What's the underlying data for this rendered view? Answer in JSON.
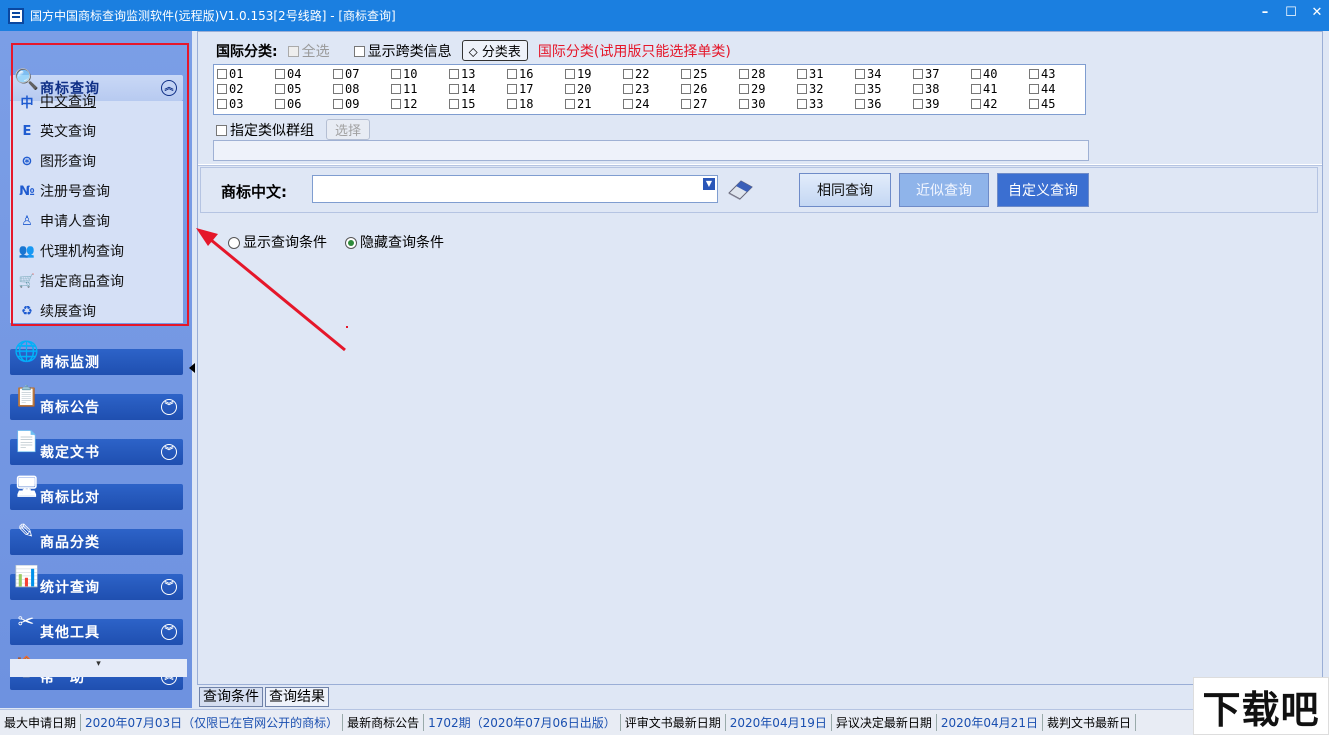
{
  "window": {
    "title": "国方中国商标查询监测软件(远程版)V1.0.153[2号线路] - [商标查询]",
    "controls": [
      "–",
      "☐",
      "✕"
    ]
  },
  "sidebar": {
    "open_section": {
      "label": "商标查询",
      "icon": "magnifier-icon"
    },
    "sub_items": [
      {
        "label": "中文查询",
        "icon": "chinese-icon",
        "glyph": "中",
        "active": true
      },
      {
        "label": "英文查询",
        "icon": "english-icon",
        "glyph": "E",
        "active": false
      },
      {
        "label": "图形查询",
        "icon": "shape-icon",
        "glyph": "⊛",
        "active": false
      },
      {
        "label": "注册号查询",
        "icon": "number-icon",
        "glyph": "№",
        "active": false
      },
      {
        "label": "申请人查询",
        "icon": "person-icon",
        "glyph": "♙",
        "active": false
      },
      {
        "label": "代理机构查询",
        "icon": "agency-icon",
        "glyph": "👥",
        "active": false
      },
      {
        "label": "指定商品查询",
        "icon": "goods-icon",
        "glyph": "🛒",
        "active": false
      },
      {
        "label": "续展查询",
        "icon": "renew-icon",
        "glyph": "♻",
        "active": false
      }
    ],
    "sections": [
      {
        "label": "商标监测",
        "icon": "monitor-icon",
        "glyph": "🌐",
        "chevron": false
      },
      {
        "label": "商标公告",
        "icon": "bulletin-icon",
        "glyph": "📋",
        "chevron": true
      },
      {
        "label": "裁定文书",
        "icon": "document-icon",
        "glyph": "📄",
        "chevron": true
      },
      {
        "label": "商标比对",
        "icon": "compare-icon",
        "glyph": "🖥",
        "chevron": false
      },
      {
        "label": "商品分类",
        "icon": "category-icon",
        "glyph": "✎",
        "chevron": false
      },
      {
        "label": "统计查询",
        "icon": "stats-icon",
        "glyph": "📊",
        "chevron": true
      },
      {
        "label": "其他工具",
        "icon": "tools-icon",
        "glyph": "✂",
        "chevron": true
      },
      {
        "label": "帮　助",
        "icon": "help-icon",
        "glyph": "🏠",
        "chevron": true
      }
    ],
    "more_indicator": "▾"
  },
  "classification": {
    "label": "国际分类:",
    "select_all": "全选",
    "show_cross": "显示跨类信息",
    "class_table_button": "分类表",
    "notice": "国际分类(试用版只能选择单类)",
    "classes": [
      "01",
      "02",
      "03",
      "04",
      "05",
      "06",
      "07",
      "08",
      "09",
      "10",
      "11",
      "12",
      "13",
      "14",
      "15",
      "16",
      "17",
      "18",
      "19",
      "20",
      "21",
      "22",
      "23",
      "24",
      "25",
      "26",
      "27",
      "28",
      "29",
      "30",
      "31",
      "32",
      "33",
      "34",
      "35",
      "36",
      "37",
      "38",
      "39",
      "40",
      "41",
      "42",
      "43",
      "44",
      "45"
    ],
    "similar_group": "指定类似群组",
    "select_button": "选择"
  },
  "query": {
    "label": "商标中文:",
    "input_value": "",
    "buttons": {
      "same": "相同查询",
      "near": "近似查询",
      "custom": "自定义查询"
    },
    "show_conditions": "显示查询条件",
    "hide_conditions": "隐藏查询条件",
    "selected_condition": "hide"
  },
  "tabs": [
    "查询条件",
    "查询结果"
  ],
  "status": [
    {
      "text": "最大申请日期",
      "blue": false
    },
    {
      "text": "2020年07月03日（仅限已在官网公开的商标）",
      "blue": true
    },
    {
      "text": "最新商标公告",
      "blue": false
    },
    {
      "text": "1702期（2020年07月06日出版）",
      "blue": true
    },
    {
      "text": "评审文书最新日期",
      "blue": false
    },
    {
      "text": "2020年04月19日",
      "blue": true
    },
    {
      "text": "异议决定最新日期",
      "blue": false
    },
    {
      "text": "2020年04月21日",
      "blue": true
    },
    {
      "text": "裁判文书最新日",
      "blue": false
    }
  ],
  "watermark": "下载吧",
  "colors": {
    "accent": "#1b7fe0",
    "highlight": "#e5172a",
    "section": "#2d63c8"
  }
}
